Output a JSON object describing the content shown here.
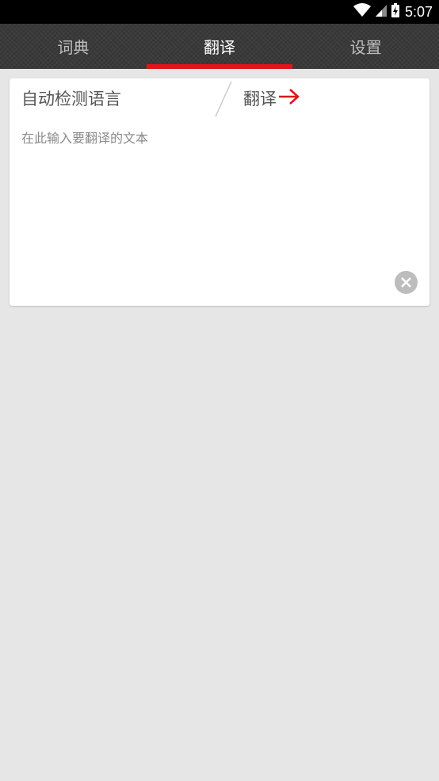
{
  "status_bar": {
    "time": "5:07",
    "icons": [
      "wifi-icon",
      "signal-icon",
      "battery-icon"
    ]
  },
  "tabs": [
    {
      "label": "词典",
      "active": false
    },
    {
      "label": "翻译",
      "active": true
    },
    {
      "label": "设置",
      "active": false
    }
  ],
  "translate": {
    "source_language": "自动检测语言",
    "target_label": "翻译",
    "input_placeholder": "在此输入要翻译的文本",
    "input_value": ""
  },
  "colors": {
    "accent": "#e0141b",
    "tab_bar_bg": "#3a3a3a",
    "page_bg": "#e6e6e6"
  }
}
